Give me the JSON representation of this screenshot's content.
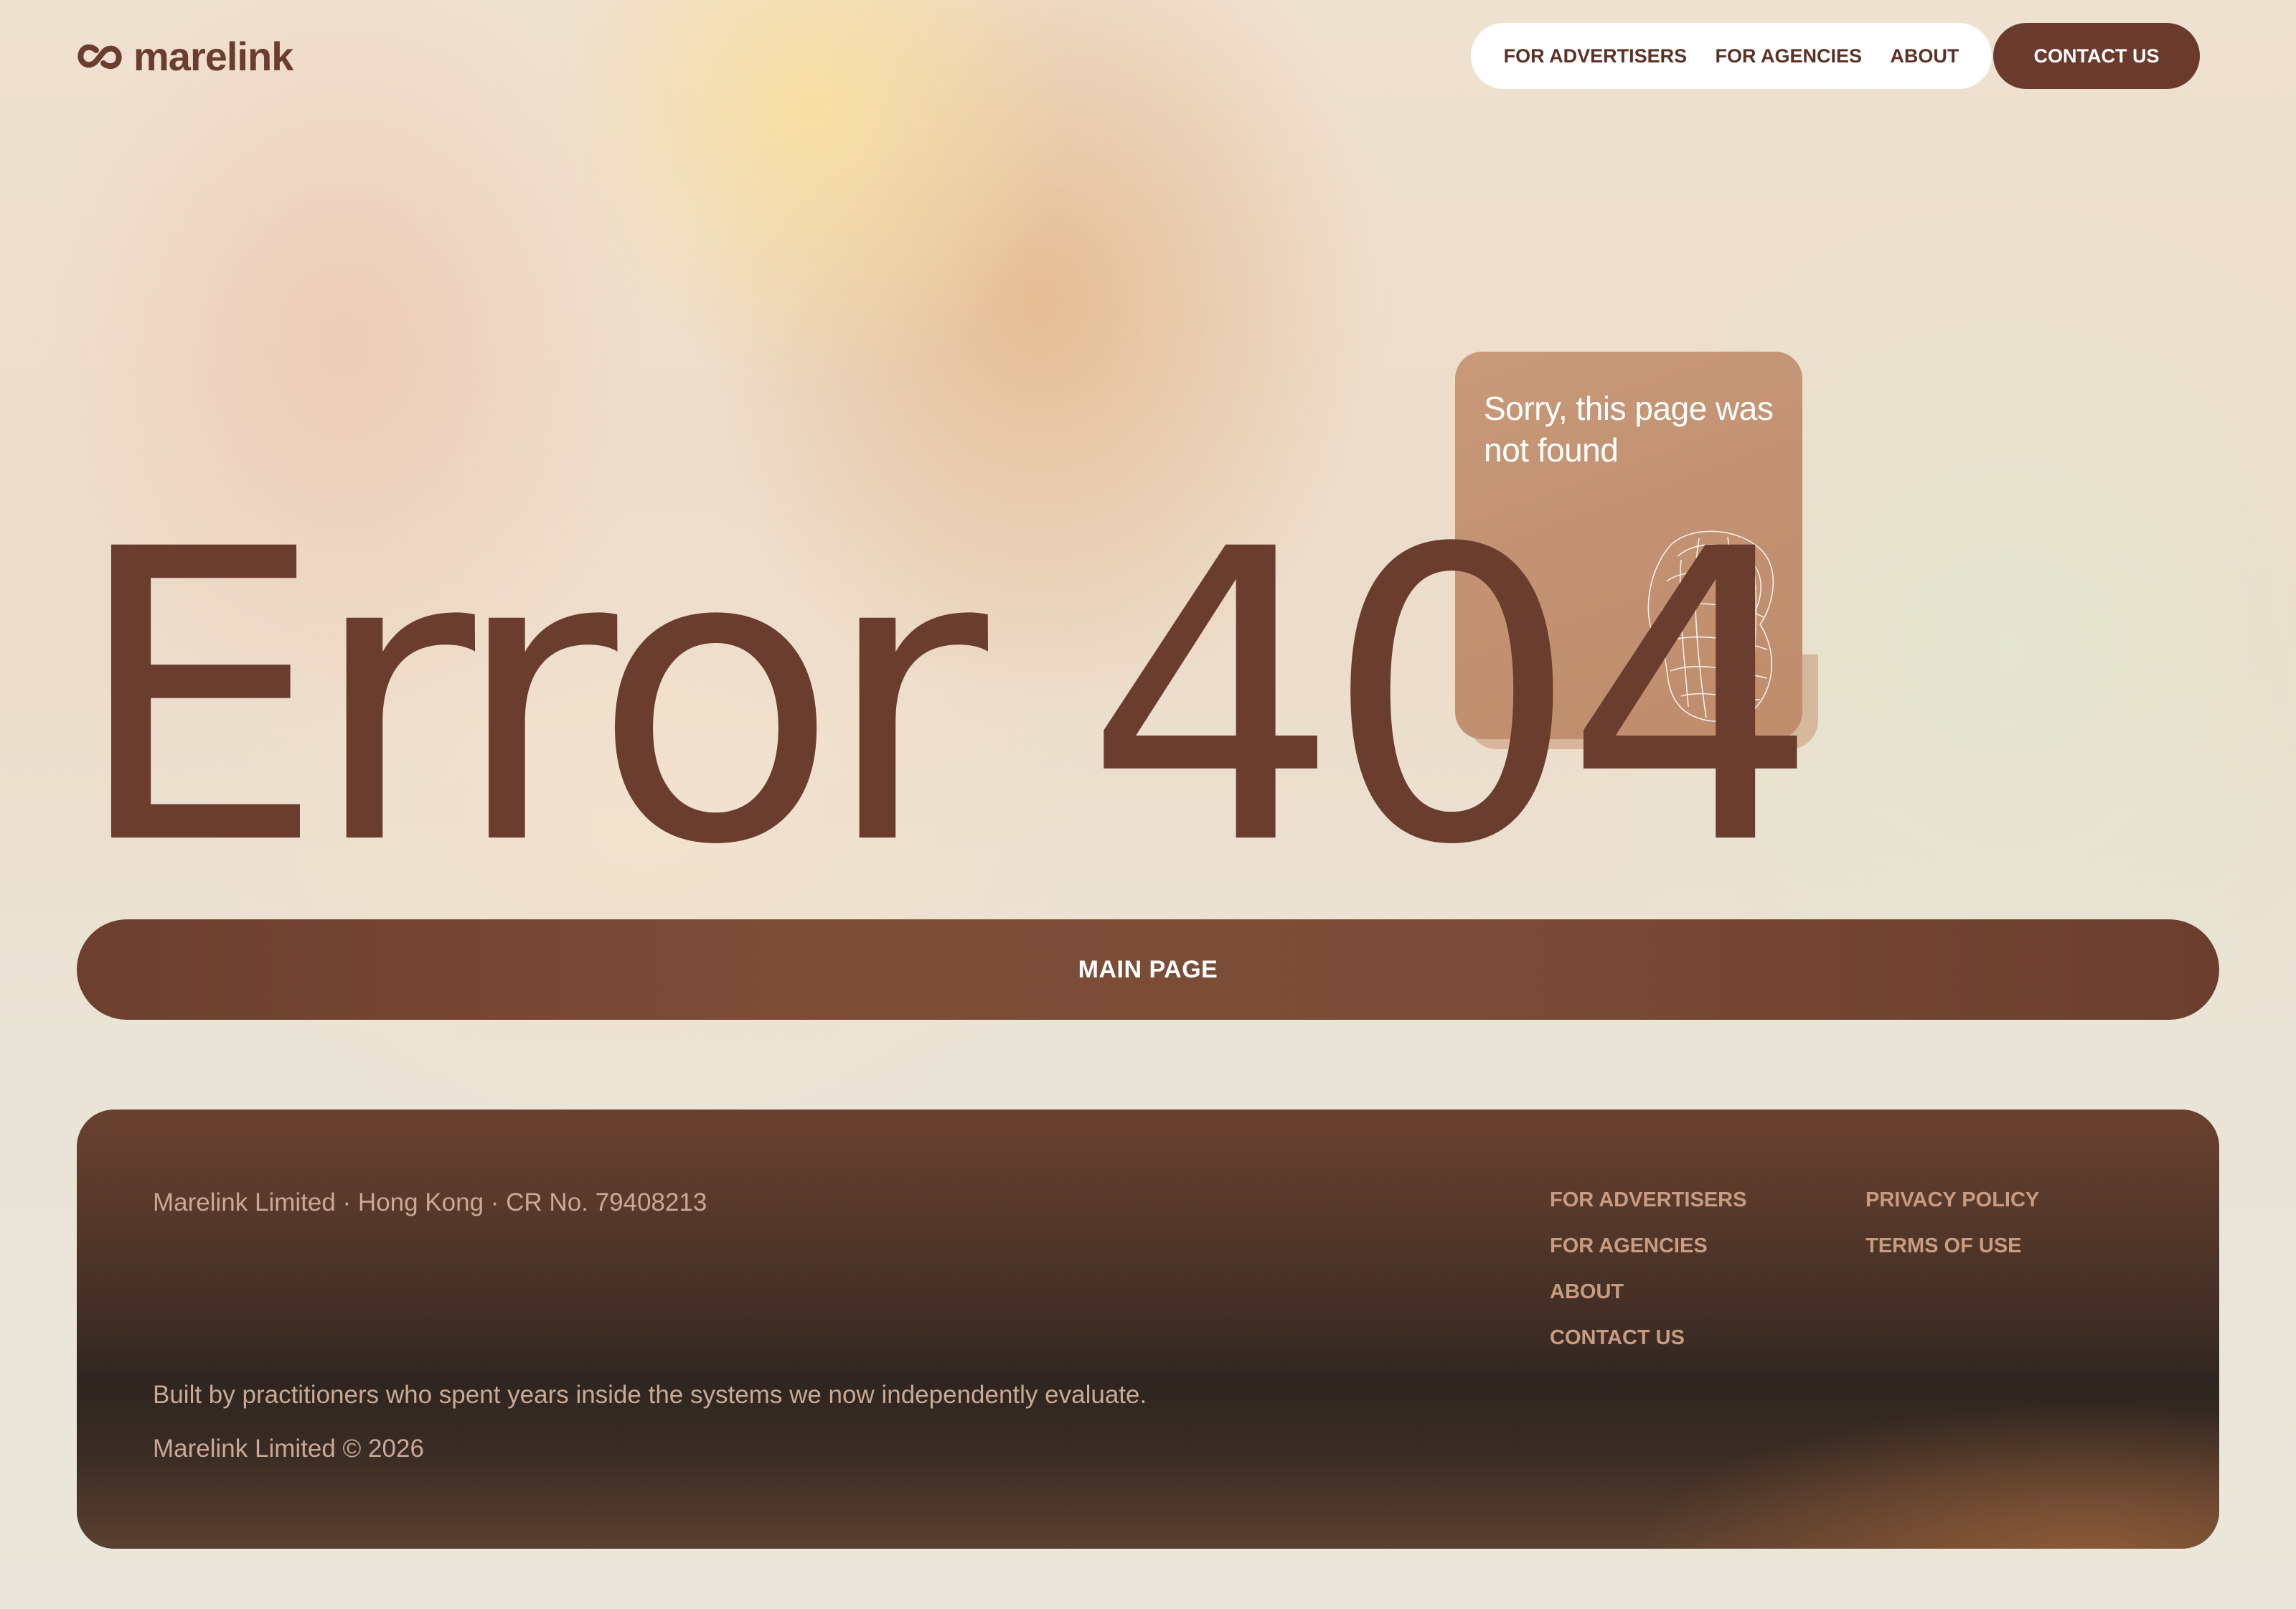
{
  "brand": {
    "name": "marelink",
    "logo_icon": "chain-link-icon"
  },
  "header": {
    "nav": [
      "FOR ADVERTISERS",
      "FOR AGENCIES",
      "ABOUT"
    ],
    "contact_label": "CONTACT US"
  },
  "hero": {
    "headline": "Error 404",
    "card_message": "Sorry, this page was not found",
    "card_object": "wireframe-sculpture-icon"
  },
  "main_button": "MAIN PAGE",
  "footer": {
    "company": "Marelink Limited · Hong Kong · CR No. 79408213",
    "tagline": "Built by practitioners who spent years inside the systems we now independently evaluate.",
    "copyright": "Marelink Limited © 2026",
    "links_primary": [
      "FOR ADVERTISERS",
      "FOR AGENCIES",
      "ABOUT",
      "CONTACT US"
    ],
    "links_legal": [
      "PRIVACY POLICY",
      "TERMS OF USE"
    ]
  },
  "colors": {
    "brand_brown": "#6a3b2c",
    "footer_link": "#c99b80",
    "footer_text": "#c9a996",
    "card": "#c29272"
  }
}
